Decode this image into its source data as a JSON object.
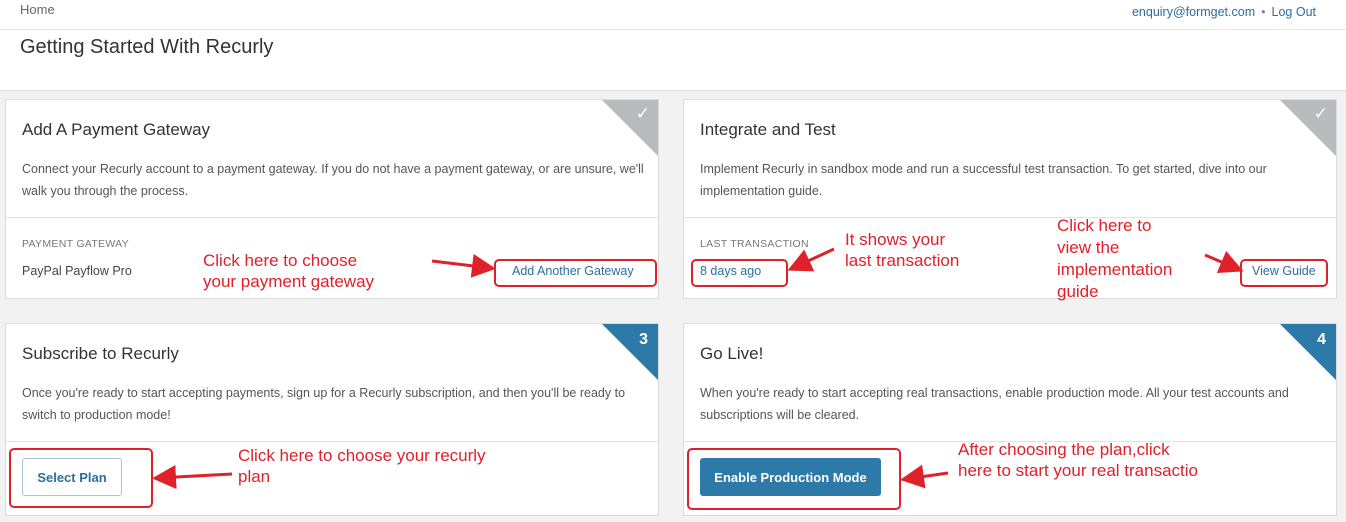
{
  "header": {
    "breadcrumb": "Home",
    "user_email": "enquiry@formget.com",
    "separator": "•",
    "logout": "Log Out",
    "title": "Getting Started With Recurly"
  },
  "cards": {
    "gateway": {
      "title": "Add A Payment Gateway",
      "description": "Connect your Recurly account to a payment gateway. If you do not have a payment gateway, or are unsure, we'll walk you through the process.",
      "badge": "✓",
      "label": "PAYMENT GATEWAY",
      "value": "PayPal Payflow Pro",
      "action": "Add Another Gateway"
    },
    "integrate": {
      "title": "Integrate and Test",
      "description": "Implement Recurly in sandbox mode and run a successful test transaction. To get started, dive into our implementation guide.",
      "badge": "✓",
      "label": "LAST TRANSACTION",
      "value": "8 days ago",
      "action": "View Guide"
    },
    "subscribe": {
      "title": "Subscribe to Recurly",
      "description": "Once you're ready to start accepting payments, sign up for a Recurly subscription, and then you'll be ready to switch to production mode!",
      "badge": "3",
      "action": "Select Plan"
    },
    "golive": {
      "title": "Go Live!",
      "description": "When you're ready to start accepting real transactions, enable production mode. All your test accounts and subscriptions will be cleared.",
      "badge": "4",
      "action": "Enable Production Mode"
    }
  },
  "annotations": {
    "gateway_line1": "Click here to choose",
    "gateway_line2": "your payment gateway",
    "transaction_line1": "It shows your",
    "transaction_line2": "last transaction",
    "guide_line1": "Click here to",
    "guide_line2": "view the",
    "guide_line3": "implementation",
    "guide_line4": "guide",
    "plan_line1": "Click here to choose your recurly",
    "plan_line2": "plan",
    "live_line1": "After choosing the plan,click",
    "live_line2": "here to start your real transactio"
  },
  "colors": {
    "accent": "#2d7aa8",
    "link": "#2a6f9e",
    "done_badge": "#b8bcbf",
    "annotation": "#e0202a"
  }
}
